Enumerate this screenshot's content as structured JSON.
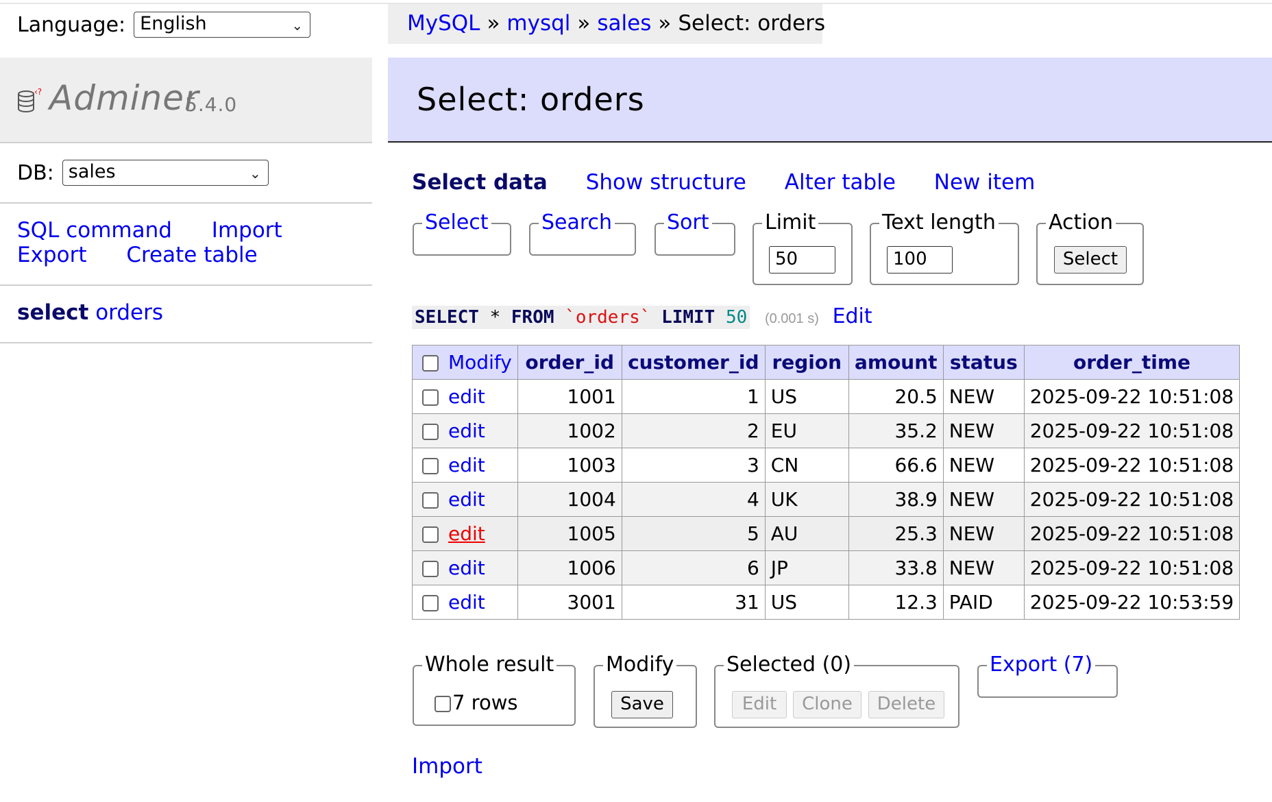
{
  "language": {
    "label": "Language:",
    "value": "English"
  },
  "logo": {
    "name": "Adminer",
    "version": "5.4.0"
  },
  "db": {
    "label": "DB:",
    "value": "sales"
  },
  "sidebar_links": {
    "sql_command": "SQL command",
    "import": "Import",
    "export": "Export",
    "create_table": "Create table"
  },
  "sidebar_table": {
    "action": "select",
    "name": "orders"
  },
  "breadcrumb": {
    "server": "MySQL",
    "sep": "»",
    "db_server": "mysql",
    "db": "sales",
    "current": "Select: orders"
  },
  "page_title": "Select: orders",
  "tabs": {
    "select_data": "Select data",
    "show_structure": "Show structure",
    "alter_table": "Alter table",
    "new_item": "New item"
  },
  "filters": {
    "select": "Select",
    "search": "Search",
    "sort": "Sort",
    "limit_label": "Limit",
    "limit_value": "50",
    "text_length_label": "Text length",
    "text_length_value": "100",
    "action_label": "Action",
    "action_button": "Select"
  },
  "sql": {
    "select": "SELECT",
    "star": "*",
    "from": "FROM",
    "table": "`orders`",
    "limit": "LIMIT",
    "limit_value": "50",
    "time": "(0.001 s)",
    "edit": "Edit"
  },
  "table": {
    "columns": [
      "Modify",
      "order_id",
      "customer_id",
      "region",
      "amount",
      "status",
      "order_time"
    ],
    "edit_label": "edit",
    "rows": [
      {
        "order_id": "1001",
        "customer_id": "1",
        "region": "US",
        "amount": "20.5",
        "status": "NEW",
        "order_time": "2025-09-22 10:51:08"
      },
      {
        "order_id": "1002",
        "customer_id": "2",
        "region": "EU",
        "amount": "35.2",
        "status": "NEW",
        "order_time": "2025-09-22 10:51:08"
      },
      {
        "order_id": "1003",
        "customer_id": "3",
        "region": "CN",
        "amount": "66.6",
        "status": "NEW",
        "order_time": "2025-09-22 10:51:08"
      },
      {
        "order_id": "1004",
        "customer_id": "4",
        "region": "UK",
        "amount": "38.9",
        "status": "NEW",
        "order_time": "2025-09-22 10:51:08"
      },
      {
        "order_id": "1005",
        "customer_id": "5",
        "region": "AU",
        "amount": "25.3",
        "status": "NEW",
        "order_time": "2025-09-22 10:51:08"
      },
      {
        "order_id": "1006",
        "customer_id": "6",
        "region": "JP",
        "amount": "33.8",
        "status": "NEW",
        "order_time": "2025-09-22 10:51:08"
      },
      {
        "order_id": "3001",
        "customer_id": "31",
        "region": "US",
        "amount": "12.3",
        "status": "PAID",
        "order_time": "2025-09-22 10:53:59"
      }
    ]
  },
  "bottom": {
    "whole_result": "Whole result",
    "rows_count": "7 rows",
    "modify": "Modify",
    "save": "Save",
    "selected": "Selected (0)",
    "edit": "Edit",
    "clone": "Clone",
    "delete": "Delete",
    "export": "Export (7)"
  },
  "import": "Import"
}
